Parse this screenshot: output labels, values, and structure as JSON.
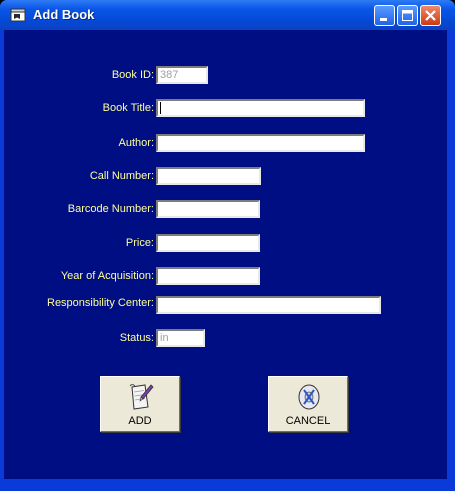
{
  "window": {
    "title": "Add Book"
  },
  "icons": {
    "app": "book-window-icon",
    "minimize": "minimize-icon",
    "maximize": "maximize-icon",
    "close": "close-icon",
    "add": "add-document-icon",
    "cancel": "cancel-disc-icon"
  },
  "colors": {
    "background": "#000e84",
    "label_text": "#ffff9c",
    "titlebar": "#0a56e8"
  },
  "form": {
    "book_id": {
      "label": "Book ID:",
      "value": "387"
    },
    "book_title": {
      "label": "Book Title:",
      "value": ""
    },
    "author": {
      "label": "Author:",
      "value": ""
    },
    "call_number": {
      "label": "Call Number:",
      "value": ""
    },
    "barcode_number": {
      "label": "Barcode Number:",
      "value": ""
    },
    "price": {
      "label": "Price:",
      "value": ""
    },
    "year_of_acquisition": {
      "label": "Year of Acquisition:",
      "value": ""
    },
    "responsibility_center": {
      "label": "Responsibility Center:",
      "value": ""
    },
    "status": {
      "label": "Status:",
      "value": "in"
    }
  },
  "buttons": {
    "add": "ADD",
    "cancel": "CANCEL"
  }
}
